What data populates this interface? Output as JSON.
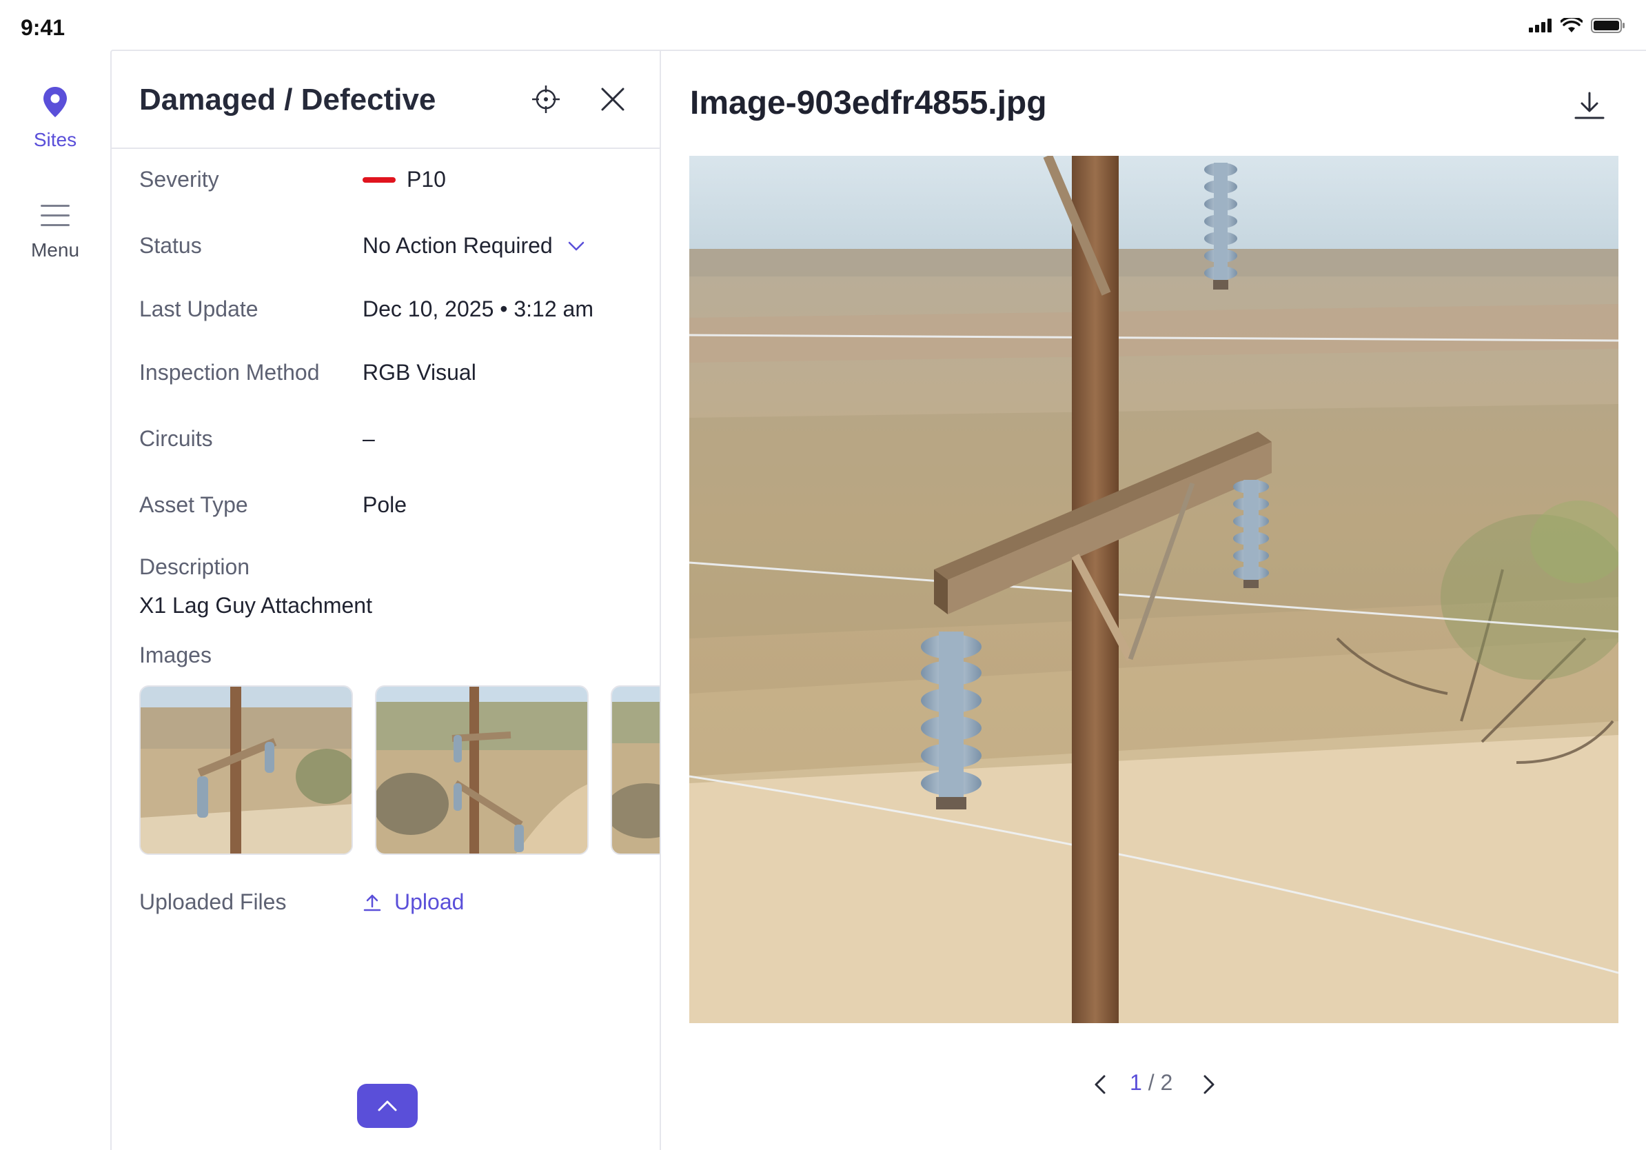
{
  "status_bar": {
    "time": "9:41"
  },
  "rail": {
    "sites_label": "Sites",
    "menu_label": "Menu"
  },
  "panel": {
    "title": "Damaged / Defective",
    "fields": {
      "severity": {
        "label": "Severity",
        "value": "P10",
        "color": "#e0141e"
      },
      "status": {
        "label": "Status",
        "value": "No Action Required"
      },
      "last_update": {
        "label": "Last Update",
        "value": "Dec 10, 2025 • 3:12 am"
      },
      "inspection_method": {
        "label": "Inspection Method",
        "value": "RGB Visual"
      },
      "circuits": {
        "label": "Circuits",
        "value": "–"
      },
      "asset_type": {
        "label": "Asset Type",
        "value": "Pole"
      }
    },
    "description": {
      "label": "Description",
      "value": "X1 Lag Guy Attachment"
    },
    "images_label": "Images",
    "uploaded_files": {
      "label": "Uploaded Files",
      "upload_label": "Upload"
    }
  },
  "viewer": {
    "filename": "Image-903edfr4855.jpg",
    "pager": {
      "current": "1",
      "separator": " / ",
      "total": "2"
    }
  },
  "colors": {
    "accent": "#5a4fd9",
    "severity": "#e0141e"
  }
}
